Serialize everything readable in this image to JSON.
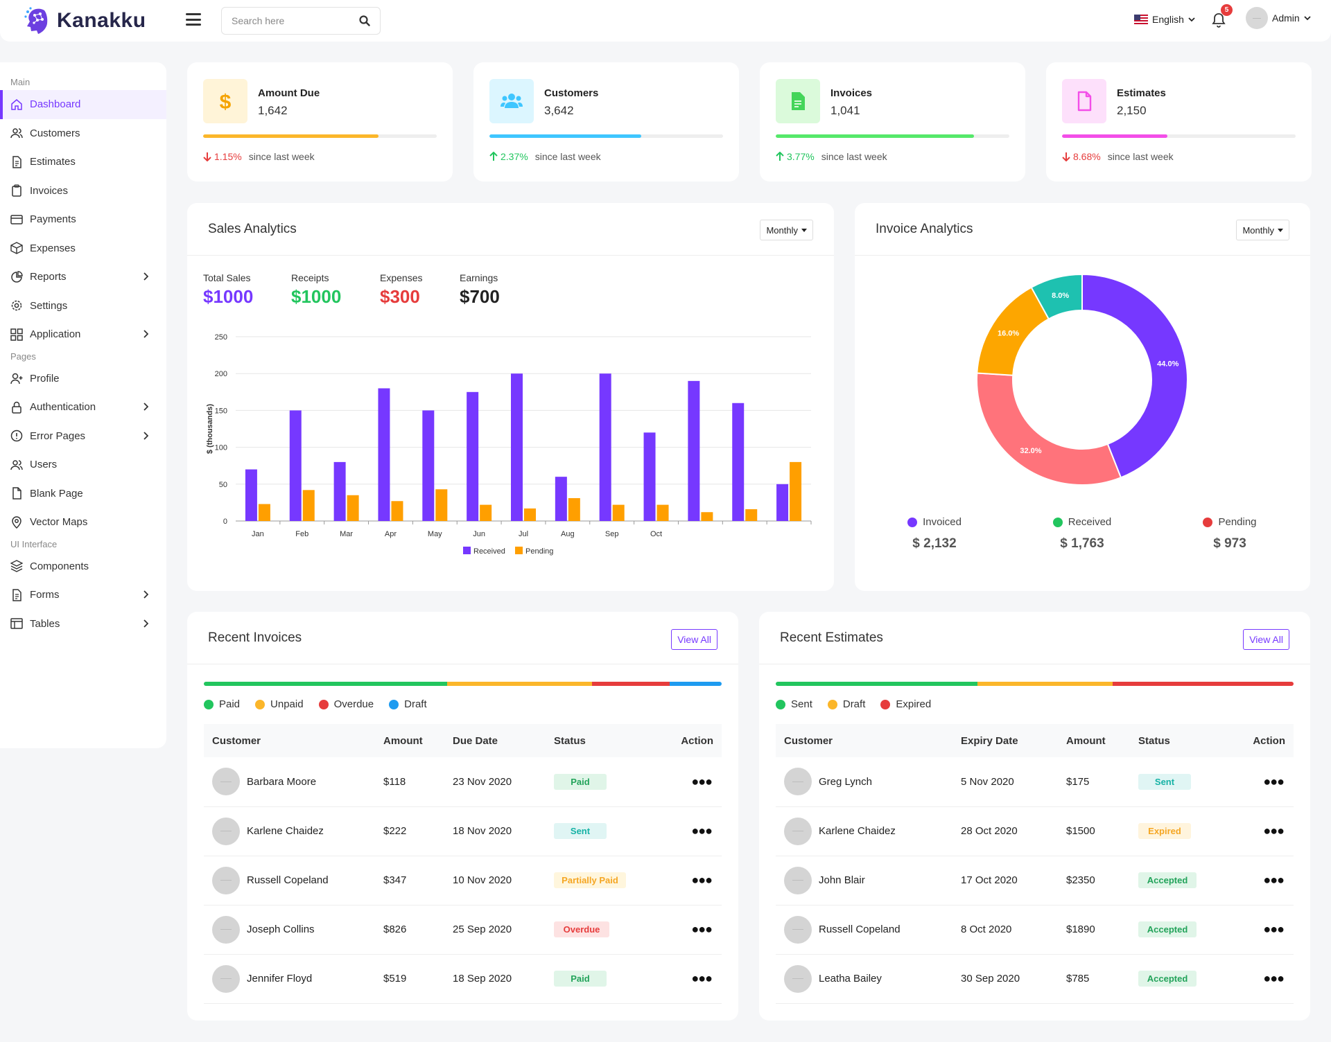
{
  "header": {
    "brand": "Kanakku",
    "search_placeholder": "Search here",
    "language": "English",
    "notifications": "5",
    "user": "Admin"
  },
  "sidebar": {
    "sections": [
      {
        "title": "Main",
        "items": [
          "Dashboard",
          "Customers",
          "Estimates",
          "Invoices",
          "Payments",
          "Expenses",
          "Reports",
          "Settings",
          "Application"
        ]
      },
      {
        "title": "Pages",
        "items": [
          "Profile",
          "Authentication",
          "Error Pages",
          "Users",
          "Blank Page",
          "Vector Maps"
        ]
      },
      {
        "title": "UI Interface",
        "items": [
          "Components",
          "Forms",
          "Tables"
        ]
      }
    ]
  },
  "stats": [
    {
      "title": "Amount Due",
      "value": "1,642",
      "change": "1.15%",
      "dir": "down",
      "since": "since last week",
      "progress": 75,
      "color": "#fbb62a",
      "icon_bg": "#fff4d8",
      "icon": "dollar-icon"
    },
    {
      "title": "Customers",
      "value": "3,642",
      "change": "2.37%",
      "dir": "up",
      "since": "since last week",
      "progress": 65,
      "color": "#3fc6ff",
      "icon_bg": "#dcf6ff",
      "icon": "users-icon"
    },
    {
      "title": "Invoices",
      "value": "1,041",
      "change": "3.77%",
      "dir": "up",
      "since": "since last week",
      "progress": 85,
      "color": "#55e86a",
      "icon_bg": "#dbfadb",
      "icon": "file-icon"
    },
    {
      "title": "Estimates",
      "value": "2,150",
      "change": "8.68%",
      "dir": "down",
      "since": "since last week",
      "progress": 45,
      "color": "#f34ee8",
      "icon_bg": "#fde0fb",
      "icon": "document-icon"
    }
  ],
  "sales": {
    "title": "Sales Analytics",
    "filter": "Monthly",
    "kpis": [
      {
        "label": "Total Sales",
        "value": "$1000",
        "color": "#7638ff"
      },
      {
        "label": "Receipts",
        "value": "$1000",
        "color": "#22c55e"
      },
      {
        "label": "Expenses",
        "value": "$300",
        "color": "#e63c3c"
      },
      {
        "label": "Earnings",
        "value": "$700",
        "color": "#222222"
      }
    ]
  },
  "invoice_analytics": {
    "title": "Invoice Analytics",
    "filter": "Monthly",
    "legend": [
      {
        "label": "Invoiced",
        "value": "$ 2,132",
        "color": "#7638ff"
      },
      {
        "label": "Received",
        "value": "$ 1,763",
        "color": "#22c55e"
      },
      {
        "label": "Pending",
        "value": "$ 973",
        "color": "#e63c3c"
      }
    ]
  },
  "chart_data": [
    {
      "type": "bar",
      "categories": [
        "Jan",
        "Feb",
        "Mar",
        "Apr",
        "May",
        "Jun",
        "Jul",
        "Aug",
        "Sep",
        "Oct",
        "",
        "",
        ""
      ],
      "series": [
        {
          "name": "Received",
          "color": "#7638ff",
          "values": [
            70,
            150,
            80,
            180,
            150,
            175,
            200,
            60,
            200,
            120,
            190,
            160,
            50
          ]
        },
        {
          "name": "Pending",
          "color": "#ff9f00",
          "values": [
            23,
            42,
            35,
            27,
            43,
            22,
            17,
            31,
            22,
            22,
            12,
            16,
            80
          ]
        }
      ],
      "ylabel": "$ (thousands)",
      "ylim": [
        0,
        250
      ],
      "yticks": [
        0,
        50,
        100,
        150,
        200,
        250
      ],
      "grid": true,
      "legend": "bottom"
    },
    {
      "type": "pie",
      "labels": [
        "",
        "",
        "",
        ""
      ],
      "values": [
        44.0,
        32.0,
        16.0,
        8.0
      ],
      "display": [
        "44.0%",
        "32.0%",
        "16.0%",
        "8.0%"
      ],
      "colors": [
        "#7638ff",
        "#ff737b",
        "#fda600",
        "#1ec1b0"
      ]
    }
  ],
  "recent_invoices": {
    "title": "Recent Invoices",
    "view_all": "View All",
    "stack": [
      {
        "label": "Paid",
        "pct": 47,
        "color": "#22c55e"
      },
      {
        "label": "Unpaid",
        "pct": 28,
        "color": "#fbb62a"
      },
      {
        "label": "Overdue",
        "pct": 15,
        "color": "#e63c3c"
      },
      {
        "label": "Draft",
        "pct": 10,
        "color": "#1e9bf0"
      }
    ],
    "columns": [
      "Customer",
      "Amount",
      "Due Date",
      "Status",
      "Action"
    ],
    "rows": [
      {
        "name": "Barbara Moore",
        "amount": "$118",
        "date": "23 Nov 2020",
        "status": "Paid",
        "cls": "paid"
      },
      {
        "name": "Karlene Chaidez",
        "amount": "$222",
        "date": "18 Nov 2020",
        "status": "Sent",
        "cls": "sent"
      },
      {
        "name": "Russell Copeland",
        "amount": "$347",
        "date": "10 Nov 2020",
        "status": "Partially Paid",
        "cls": "partial"
      },
      {
        "name": "Joseph Collins",
        "amount": "$826",
        "date": "25 Sep 2020",
        "status": "Overdue",
        "cls": "overdue"
      },
      {
        "name": "Jennifer Floyd",
        "amount": "$519",
        "date": "18 Sep 2020",
        "status": "Paid",
        "cls": "paid"
      }
    ]
  },
  "recent_estimates": {
    "title": "Recent Estimates",
    "view_all": "View All",
    "stack": [
      {
        "label": "Sent",
        "pct": 39,
        "color": "#22c55e"
      },
      {
        "label": "Draft",
        "pct": 26,
        "color": "#fbb62a"
      },
      {
        "label": "Expired",
        "pct": 35,
        "color": "#e63c3c"
      }
    ],
    "columns": [
      "Customer",
      "Expiry Date",
      "Amount",
      "Status",
      "Action"
    ],
    "rows": [
      {
        "name": "Greg Lynch",
        "date": "5 Nov 2020",
        "amount": "$175",
        "status": "Sent",
        "cls": "sent"
      },
      {
        "name": "Karlene Chaidez",
        "date": "28 Oct 2020",
        "amount": "$1500",
        "status": "Expired",
        "cls": "expired"
      },
      {
        "name": "John Blair",
        "date": "17 Oct 2020",
        "amount": "$2350",
        "status": "Accepted",
        "cls": "accepted"
      },
      {
        "name": "Russell Copeland",
        "date": "8 Oct 2020",
        "amount": "$1890",
        "status": "Accepted",
        "cls": "accepted"
      },
      {
        "name": "Leatha Bailey",
        "date": "30 Sep 2020",
        "amount": "$785",
        "status": "Accepted",
        "cls": "accepted"
      }
    ]
  }
}
